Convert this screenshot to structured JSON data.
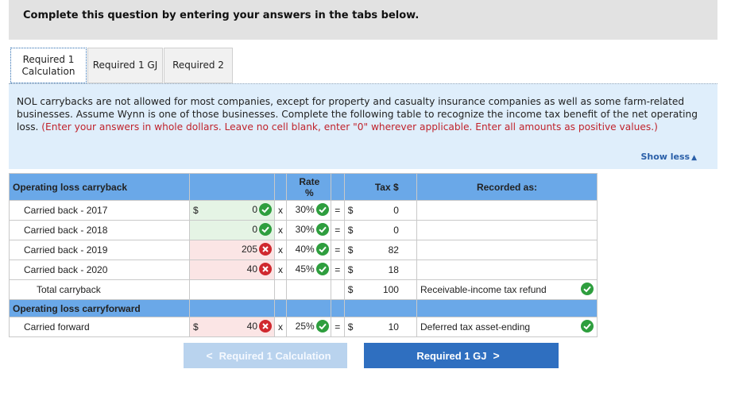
{
  "header": {
    "title": "Complete this question by entering your answers in the tabs below."
  },
  "tabs": [
    {
      "label_line1": "Required 1",
      "label_line2": "Calculation",
      "active": true
    },
    {
      "label_line1": "Required 1 GJ",
      "label_line2": "",
      "active": false
    },
    {
      "label_line1": "Required 2",
      "label_line2": "",
      "active": false
    }
  ],
  "instructions": {
    "text": "NOL carrybacks are not allowed for most companies, except for property and casualty insurance companies as well as some farm-related businesses. Assume Wynn is one of those businesses. Complete the following table to recognize the income tax benefit of the net operating loss.",
    "note": "(Enter your answers in whole dollars. Leave no cell blank, enter \"0\" wherever applicable. Enter all amounts as positive values.)",
    "show_less": "Show less"
  },
  "table": {
    "headers": {
      "label": "Operating loss carryback",
      "rate_line1": "Rate",
      "rate_line2": "%",
      "tax": "Tax $",
      "recorded": "Recorded as:"
    },
    "symbols": {
      "dollar": "$",
      "times": "x",
      "equals": "="
    },
    "rows": [
      {
        "label": "Carried back - 2017",
        "amount": "0",
        "amount_status": "correct",
        "rate": "30%",
        "rate_status": "correct",
        "tax": "0"
      },
      {
        "label": "Carried back - 2018",
        "amount": "0",
        "amount_status": "correct",
        "rate": "30%",
        "rate_status": "correct",
        "tax": "0"
      },
      {
        "label": "Carried back - 2019",
        "amount": "205",
        "amount_status": "incorrect",
        "rate": "40%",
        "rate_status": "correct",
        "tax": "82"
      },
      {
        "label": "Carried back - 2020",
        "amount": "40",
        "amount_status": "incorrect",
        "rate": "45%",
        "rate_status": "correct",
        "tax": "18"
      }
    ],
    "total": {
      "label": "Total carryback",
      "tax": "100",
      "recorded": "Receivable-income tax refund",
      "recorded_status": "correct"
    },
    "forward_section": "Operating loss carryforward",
    "forward": {
      "label": "Carried forward",
      "amount": "40",
      "amount_status": "incorrect",
      "rate": "25%",
      "rate_status": "correct",
      "tax": "10",
      "recorded": "Deferred tax asset-ending",
      "recorded_status": "correct"
    }
  },
  "buttons": {
    "prev_label": "Required 1 Calculation",
    "next_label": "Required 1 GJ"
  },
  "colors": {
    "header_blue": "#6aa8e8",
    "correct": "#2e9e3e",
    "incorrect": "#d0282e",
    "next_button": "#2f6fc0",
    "prev_button": "#b9d3ee"
  }
}
